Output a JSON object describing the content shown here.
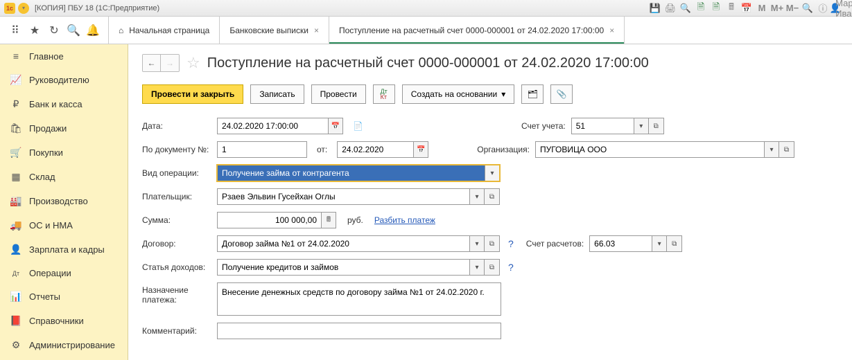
{
  "titlebar": {
    "app_title": "[КОПИЯ] ПБУ 18  (1С:Предприятие)",
    "user_name": "Мария Ивано"
  },
  "tabs": {
    "home": "Начальная страница",
    "t1": "Банковские выписки",
    "t2": "Поступление на расчетный счет 0000-000001 от 24.02.2020 17:00:00"
  },
  "sidebar": {
    "items": [
      {
        "label": "Главное",
        "icon": "≡"
      },
      {
        "label": "Руководителю",
        "icon": "📈"
      },
      {
        "label": "Банк и касса",
        "icon": "₽"
      },
      {
        "label": "Продажи",
        "icon": "🛍"
      },
      {
        "label": "Покупки",
        "icon": "🛒"
      },
      {
        "label": "Склад",
        "icon": "▦"
      },
      {
        "label": "Производство",
        "icon": "🏭"
      },
      {
        "label": "ОС и НМА",
        "icon": "🚚"
      },
      {
        "label": "Зарплата и кадры",
        "icon": "👤"
      },
      {
        "label": "Операции",
        "icon": "Дт"
      },
      {
        "label": "Отчеты",
        "icon": "📊"
      },
      {
        "label": "Справочники",
        "icon": "📕"
      },
      {
        "label": "Администрирование",
        "icon": "⚙"
      }
    ]
  },
  "doc": {
    "title": "Поступление на расчетный счет 0000-000001 от 24.02.2020 17:00:00",
    "btn_post_close": "Провести и закрыть",
    "btn_write": "Записать",
    "btn_post": "Провести",
    "btn_create_based": "Создать на основании",
    "labels": {
      "date": "Дата:",
      "account": "Счет учета:",
      "doc_no": "По документу №:",
      "from": "от:",
      "org": "Организация:",
      "op_type": "Вид операции:",
      "payer": "Плательщик:",
      "amount": "Сумма:",
      "currency": "руб.",
      "split": "Разбить платеж",
      "contract": "Договор:",
      "calc_account": "Счет расчетов:",
      "income_item": "Статья доходов:",
      "purpose": "Назначение платежа:",
      "comment": "Комментарий:"
    },
    "values": {
      "date": "24.02.2020 17:00:00",
      "account": "51",
      "doc_no": "1",
      "doc_date": "24.02.2020",
      "org": "ПУГОВИЦА ООО",
      "op_type": "Получение займа от контрагента",
      "payer": "Рзаев Эльвин Гусейхан Оглы",
      "amount": "100 000,00",
      "contract": "Договор займа №1 от 24.02.2020",
      "calc_account": "66.03",
      "income_item": "Получение кредитов и займов",
      "purpose": "Внесение денежных средств по договору займа №1 от 24.02.2020 г.",
      "comment": ""
    }
  }
}
